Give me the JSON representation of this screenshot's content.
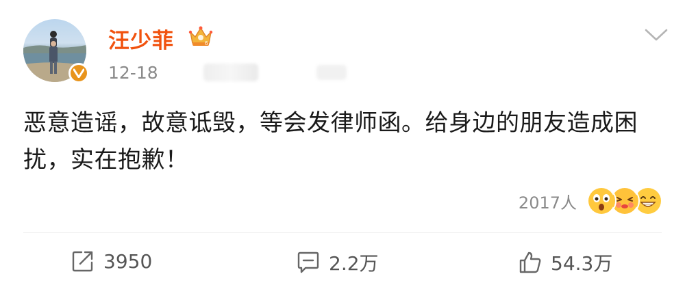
{
  "post": {
    "author": {
      "name": "汪少菲"
    },
    "date": "12-18",
    "content": "恶意造谣，故意诋毁，等会发律师函。给身边的朋友造成困扰，实在抱歉！",
    "reactions": {
      "count": "2017人",
      "emojis": [
        "surprised-emoji-icon",
        "shy-kiss-emoji-icon",
        "grin-emoji-icon"
      ]
    },
    "actions": {
      "repost": "3950",
      "comment": "2.2万",
      "like": "54.3万"
    }
  },
  "colors": {
    "username": "#f1520e",
    "verified": "#e8941c",
    "text": "#1a1a1a",
    "muted": "#8a8a8a"
  }
}
